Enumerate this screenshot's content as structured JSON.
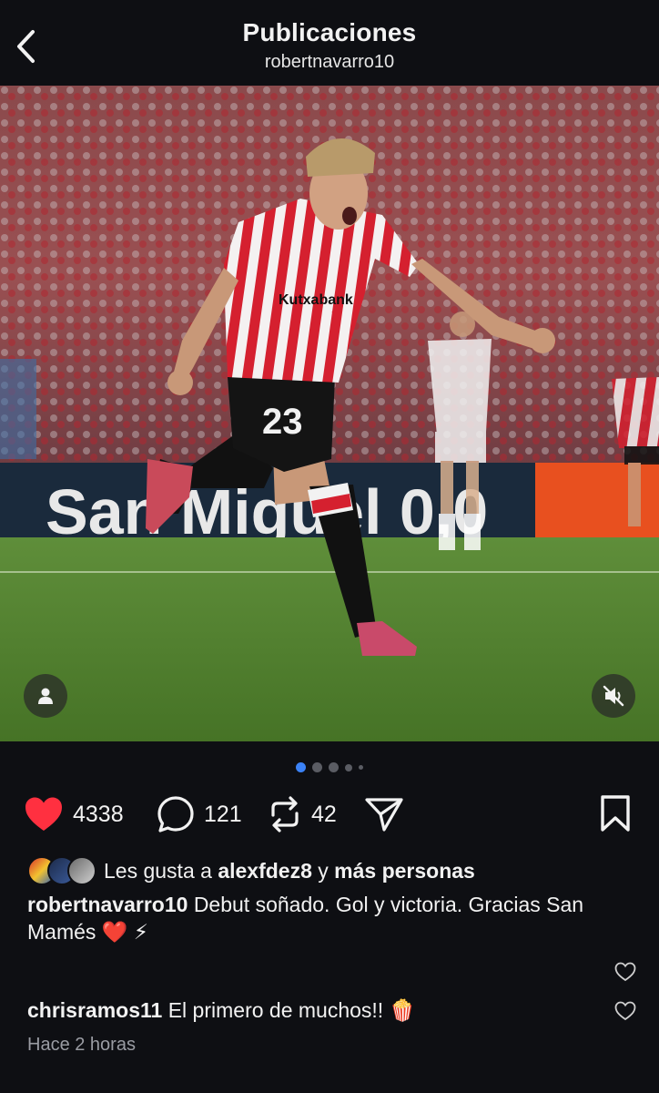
{
  "header": {
    "title": "Publicaciones",
    "username": "robertnavarro10"
  },
  "media": {
    "jersey_number": "23",
    "sponsor": "Kutxabank",
    "board_text": "San Miguel 0,0",
    "pagination": {
      "count": 5,
      "active_index": 0
    }
  },
  "actions": {
    "likes_count": "4338",
    "comments_count": "121",
    "reposts_count": "42",
    "like_color": "#ff3040"
  },
  "likes": {
    "prefix": "Les gusta a",
    "user": "alexfdez8",
    "connector": "y",
    "suffix": "más personas"
  },
  "caption": {
    "user": "robertnavarro10",
    "text": "Debut soñado. Gol y victoria. Gracias San Mamés ❤️ ⚡"
  },
  "comment": {
    "user": "chrisramos11",
    "text": "El primero de muchos!! 🍿",
    "time": "Hace 2 horas"
  }
}
